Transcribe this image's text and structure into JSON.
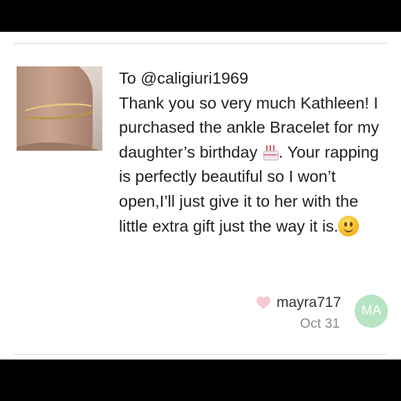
{
  "listing_image": {
    "alt": "gold herringbone ankle bracelet on ankle"
  },
  "message": {
    "to_line": "To @caligiuri1969",
    "text_part1": "Thank you so very much Kathleen! I purchased the ankle Bracelet for my daughter’s birthday ",
    "text_part2": ". Your rapping is perfectly beautiful so I won’t open,I’ll just give it to her with the little extra gift just the way it is.",
    "emoji_1": "birthday-cake-emoji",
    "emoji_2": "slightly-smiling-face-emoji"
  },
  "author": {
    "username": "mayra717",
    "date": "Oct 31",
    "avatar_initials": "MA",
    "avatar_color": "#b7e4c3"
  },
  "colors": {
    "heart": "#f6c9d0",
    "text": "#222222",
    "muted": "#8a8a8a",
    "frame": "#000000"
  }
}
